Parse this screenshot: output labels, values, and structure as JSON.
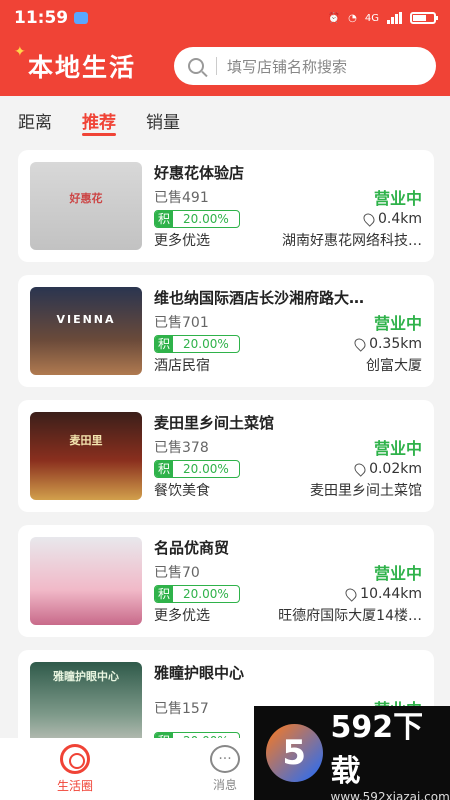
{
  "status": {
    "time": "11:59",
    "net": "4G"
  },
  "header": {
    "title": "本地生活",
    "search_placeholder": "填写店铺名称搜索"
  },
  "tabs": [
    {
      "label": "距离"
    },
    {
      "label": "推荐"
    },
    {
      "label": "销量"
    }
  ],
  "shops": [
    {
      "name": "好惠花体验店",
      "sold": "已售491",
      "status": "营业中",
      "badge_ji": "积",
      "badge_pct": "20.00%",
      "distance": "0.4km",
      "category": "更多优选",
      "address": "湖南好惠花网络科技…",
      "thumb_text": "好惠花"
    },
    {
      "name": "维也纳国际酒店长沙湘府路大…",
      "sold": "已售701",
      "status": "营业中",
      "badge_ji": "积",
      "badge_pct": "20.00%",
      "distance": "0.35km",
      "category": "酒店民宿",
      "address": "创富大厦",
      "thumb_text": "VIENNA"
    },
    {
      "name": "麦田里乡间土菜馆",
      "sold": "已售378",
      "status": "营业中",
      "badge_ji": "积",
      "badge_pct": "20.00%",
      "distance": "0.02km",
      "category": "餐饮美食",
      "address": "麦田里乡间土菜馆",
      "thumb_text": "麦田里"
    },
    {
      "name": "名品优商贸",
      "sold": "已售70",
      "status": "营业中",
      "badge_ji": "积",
      "badge_pct": "20.00%",
      "distance": "10.44km",
      "category": "更多优选",
      "address": "旺德府国际大厦14楼…",
      "thumb_text": ""
    },
    {
      "name": "雅瞳护眼中心",
      "sold": "已售157",
      "status": "营业中",
      "badge_ji": "积",
      "badge_pct": "20.00%",
      "distance": "",
      "category": "",
      "address": "",
      "thumb_text": "雅瞳护眼中心"
    }
  ],
  "bottom_nav": [
    {
      "label": "生活圈"
    },
    {
      "label": "消息"
    }
  ],
  "watermark": {
    "logo": "5",
    "brand": "592下载",
    "url": "www.592xiazai.com"
  },
  "colors": {
    "brand": "#f04336",
    "open_green": "#2fb24a"
  }
}
